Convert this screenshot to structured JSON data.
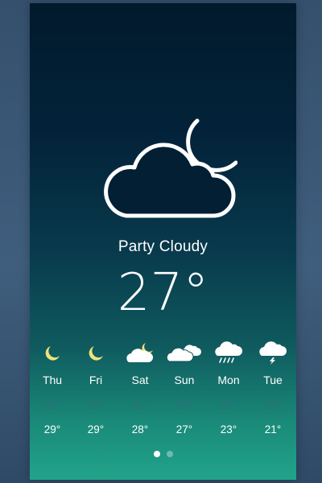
{
  "current": {
    "condition": "Party Cloudy",
    "temperature": "27°",
    "icon": "cloud-moon-icon"
  },
  "forecast": [
    {
      "day": "Thu",
      "high": "33°",
      "low": "29°",
      "icon": "moon-icon"
    },
    {
      "day": "Fri",
      "high": "35°",
      "low": "29°",
      "icon": "moon-icon"
    },
    {
      "day": "Sat",
      "high": "31°",
      "low": "28°",
      "icon": "cloud-moon-icon"
    },
    {
      "day": "Sun",
      "high": "29°",
      "low": "27°",
      "icon": "clouds-icon"
    },
    {
      "day": "Mon",
      "high": "25°",
      "low": "23°",
      "icon": "rain-cloud-icon"
    },
    {
      "day": "Tue",
      "high": "23°",
      "low": "21°",
      "icon": "thunder-cloud-icon"
    }
  ],
  "pager": {
    "pages": 2,
    "active": 1
  },
  "colors": {
    "moon": "#f3e27a",
    "low_temp": "#ffffff",
    "high_temp": "#2f6f78"
  }
}
